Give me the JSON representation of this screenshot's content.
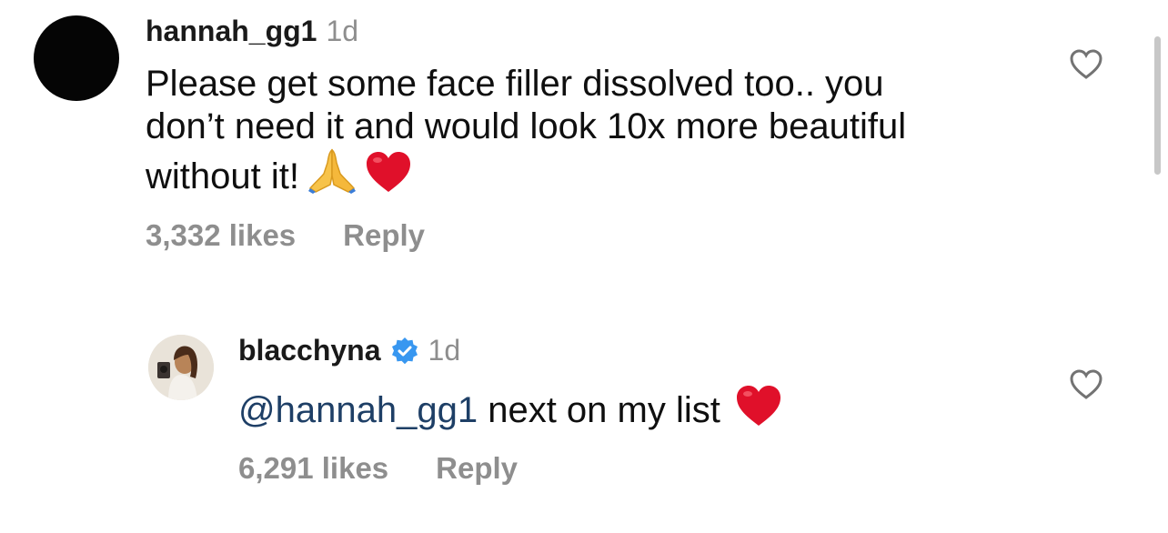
{
  "comments": [
    {
      "username": "hannah_gg1",
      "time": "1d",
      "text_lines": [
        "Please get some face filler dissolved too.. you",
        "don’t need it and would look 10x more beautiful",
        "without it!"
      ],
      "emojis": [
        "folded-hands",
        "red-heart"
      ],
      "likes": "3,332 likes",
      "reply_label": "Reply",
      "avatar": "black-circle-avatar"
    }
  ],
  "reply": {
    "username": "blacchyna",
    "verified": true,
    "time": "1d",
    "mention": "@hannah_gg1",
    "text": "next on my list",
    "emojis": [
      "red-heart"
    ],
    "likes": "6,291 likes",
    "reply_label": "Reply",
    "avatar": "profile-photo-avatar"
  },
  "icons": {
    "like": "heart-outline-icon",
    "verified": "verified-badge-icon"
  },
  "colors": {
    "mention": "#1e3f66",
    "muted": "#8e8e8e",
    "verified": "#3897f0",
    "heart_emoji": "#e0102a"
  }
}
